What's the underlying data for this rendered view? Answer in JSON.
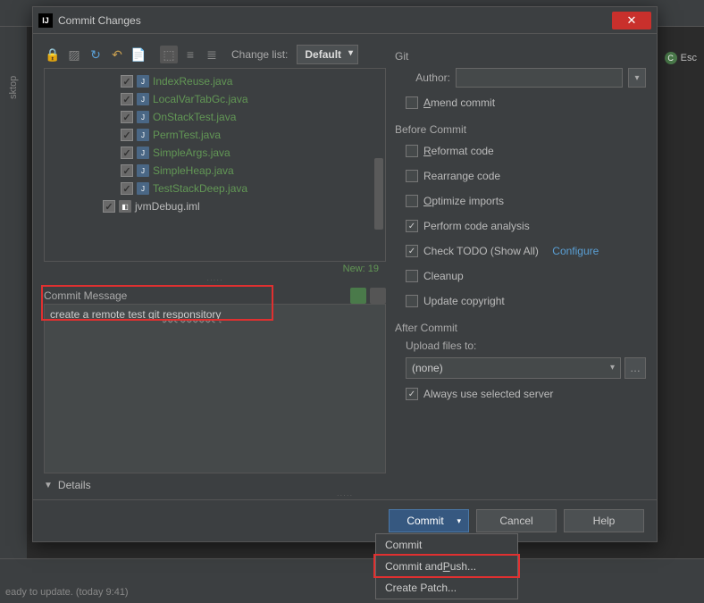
{
  "background": {
    "status_text": "eady to update. (today 9:41)",
    "left_tab": "sktop",
    "esc_label": "Esc"
  },
  "titlebar": {
    "title": "Commit Changes",
    "icon": "IJ"
  },
  "toolbar": {
    "change_list_label": "Change list:",
    "change_list_value": "Default"
  },
  "files": [
    {
      "name": "IndexReuse.java",
      "type": "java"
    },
    {
      "name": "LocalVarTabGc.java",
      "type": "java"
    },
    {
      "name": "OnStackTest.java",
      "type": "java"
    },
    {
      "name": "PermTest.java",
      "type": "java"
    },
    {
      "name": "SimpleArgs.java",
      "type": "java"
    },
    {
      "name": "SimpleHeap.java",
      "type": "java"
    },
    {
      "name": "TestStackDeep.java",
      "type": "java"
    },
    {
      "name": "jvmDebug.iml",
      "type": "iml"
    }
  ],
  "new_count": "New: 19",
  "commit_message": {
    "label": "Commit Message",
    "text_prefix": "create a remote test git ",
    "text_underlined": "responsitory"
  },
  "details_label": "Details",
  "git": {
    "section": "Git",
    "author_label": "Author:",
    "author_value": "",
    "amend_label": "Amend commit"
  },
  "before": {
    "section": "Before Commit",
    "reformat": "Reformat code",
    "rearrange": "Rearrange code",
    "optimize": "Optimize imports",
    "analysis": "Perform code analysis",
    "todo": "Check TODO (Show All)",
    "configure": "Configure",
    "cleanup": "Cleanup",
    "copyright": "Update copyright"
  },
  "after": {
    "section": "After Commit",
    "upload_label": "Upload files to:",
    "upload_value": "(none)",
    "always": "Always use selected server"
  },
  "buttons": {
    "commit": "Commit",
    "cancel": "Cancel",
    "help": "Help"
  },
  "menu": {
    "commit": "Commit",
    "commit_push_pre": "Commit and ",
    "commit_push_u": "P",
    "commit_push_suf": "ush...",
    "patch": "Create Patch..."
  }
}
